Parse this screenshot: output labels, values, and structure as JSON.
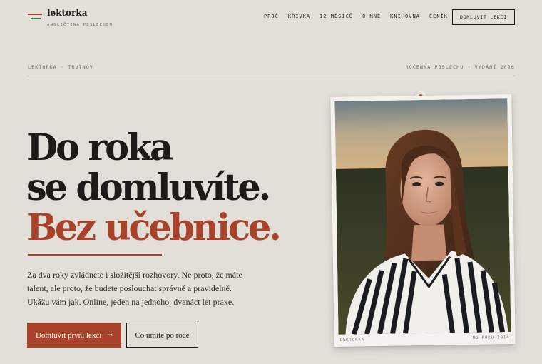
{
  "brand": {
    "name": "lektorka",
    "subtitle": "ANGLIČTINA POSLECHEM"
  },
  "nav": {
    "items": [
      {
        "label": "PROČ"
      },
      {
        "label": "KŘIVKA"
      },
      {
        "label": "12 MĚSÍCŮ"
      },
      {
        "label": "O MNĚ"
      },
      {
        "label": "KNIHOVNA"
      },
      {
        "label": "CENÍK"
      }
    ],
    "cta": "DOMLUVIT LEKCI"
  },
  "meta": {
    "left": "LEKTORKA · TRUTNOV",
    "right": "ROČENKA POSLECHU · VYDÁNÍ 2026"
  },
  "hero": {
    "line1": "Do roka",
    "line2": "se domluvíte.",
    "line3": "Bez učebnice.",
    "lead": "Za dva roky zvládnete i složitější rozhovory. Ne proto, že máte talent, ale proto, že budete poslouchat správně a pravidelně. Ukážu vám jak. Online, jeden na jednoho, dvanáct let praxe.",
    "primary_button": "Domluvit první lekci",
    "arrow": "→",
    "secondary_button": "Co umíte po roce"
  },
  "photo": {
    "caption_left": "LEKTORKA",
    "caption_right": "OD ROKU 2014"
  },
  "colors": {
    "accent": "#a8432a",
    "accent_green": "#3f7a45",
    "background": "#e2ded8",
    "ink": "#1d1a17"
  }
}
